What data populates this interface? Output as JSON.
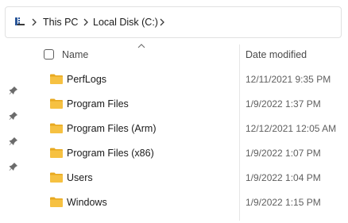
{
  "address_bar": {
    "crumbs": [
      "This PC",
      "Local Disk (C:)"
    ],
    "root_icon": "this-pc-icon",
    "separator_icon": "chevron-right-icon"
  },
  "quick_access": {
    "pin_icon": "pin-icon",
    "pin_count": 4
  },
  "file_list": {
    "columns": {
      "name": "Name",
      "date_modified": "Date modified"
    },
    "sort": {
      "column": "name",
      "direction": "ascending"
    },
    "items": [
      {
        "name": "PerfLogs",
        "date_modified": "12/11/2021 9:35 PM",
        "icon": "folder-icon"
      },
      {
        "name": "Program Files",
        "date_modified": "1/9/2022 1:37 PM",
        "icon": "folder-icon"
      },
      {
        "name": "Program Files (Arm)",
        "date_modified": "12/12/2021 12:05 AM",
        "icon": "folder-icon"
      },
      {
        "name": "Program Files (x86)",
        "date_modified": "1/9/2022 1:07 PM",
        "icon": "folder-icon"
      },
      {
        "name": "Users",
        "date_modified": "1/9/2022 1:04 PM",
        "icon": "folder-icon"
      },
      {
        "name": "Windows",
        "date_modified": "1/9/2022 1:15 PM",
        "icon": "folder-icon"
      }
    ]
  },
  "colors": {
    "folder_body": "#f6c142",
    "folder_tab": "#e8a920",
    "text": "#1a1a1a",
    "secondary_text": "#5f5f5f",
    "border": "#e1e1e1"
  }
}
